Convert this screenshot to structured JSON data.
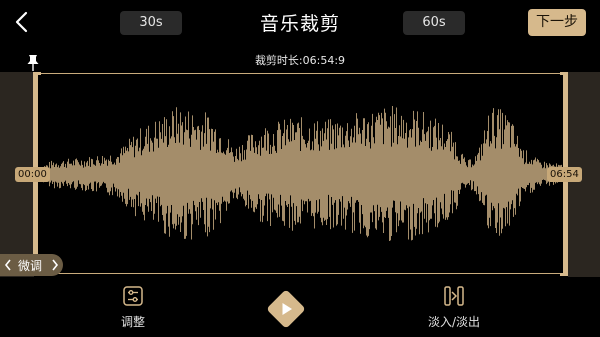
{
  "header": {
    "title": "音乐裁剪",
    "preset_short": "30s",
    "preset_long": "60s",
    "next_label": "下一步"
  },
  "duration": {
    "label": "裁剪时长:06:54:9"
  },
  "editor": {
    "start_time": "00:00",
    "end_time": "06:54",
    "fine_tune_label": "微调"
  },
  "toolbar": {
    "adjust_label": "调整",
    "fade_label": "淡入/淡出"
  },
  "colors": {
    "accent": "#d6b98c",
    "waveform": "#a48d6a",
    "shade": "#2b2620",
    "background": "#000000"
  },
  "icons": [
    "back-icon",
    "pin-icon",
    "chevron-left-icon",
    "chevron-right-icon",
    "adjust-icon",
    "play-icon",
    "fade-icon"
  ]
}
